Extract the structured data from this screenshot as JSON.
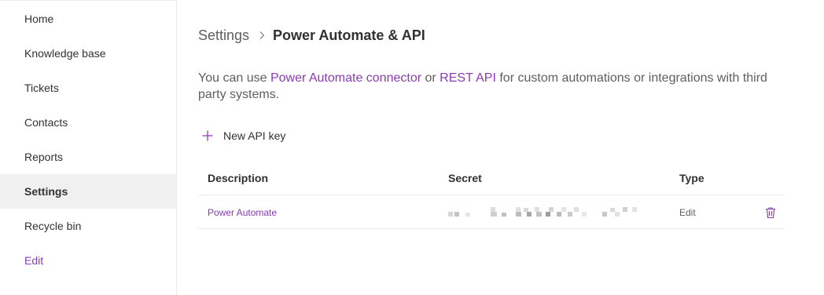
{
  "sidebar": {
    "items": [
      {
        "label": "Home"
      },
      {
        "label": "Knowledge base"
      },
      {
        "label": "Tickets"
      },
      {
        "label": "Contacts"
      },
      {
        "label": "Reports"
      },
      {
        "label": "Settings"
      },
      {
        "label": "Recycle bin"
      }
    ],
    "edit_label": "Edit"
  },
  "breadcrumb": {
    "root": "Settings",
    "current": "Power Automate & API"
  },
  "intro": {
    "prefix": "You can use ",
    "link1": "Power Automate connector",
    "middle": " or ",
    "link2": "REST API",
    "suffix": " for custom automations or integrations with third party systems."
  },
  "actions": {
    "new_key_label": "New API key"
  },
  "table": {
    "headers": {
      "description": "Description",
      "secret": "Secret",
      "type": "Type"
    },
    "rows": [
      {
        "description": "Power Automate",
        "secret": "",
        "type": "Edit"
      }
    ]
  },
  "colors": {
    "accent": "#8a3bb5",
    "active_bg": "#f0f0f0",
    "border": "#edebe9"
  },
  "icons": {
    "breadcrumb_separator": "chevron-right-icon",
    "new_key": "plus-icon",
    "delete": "trash-icon"
  }
}
